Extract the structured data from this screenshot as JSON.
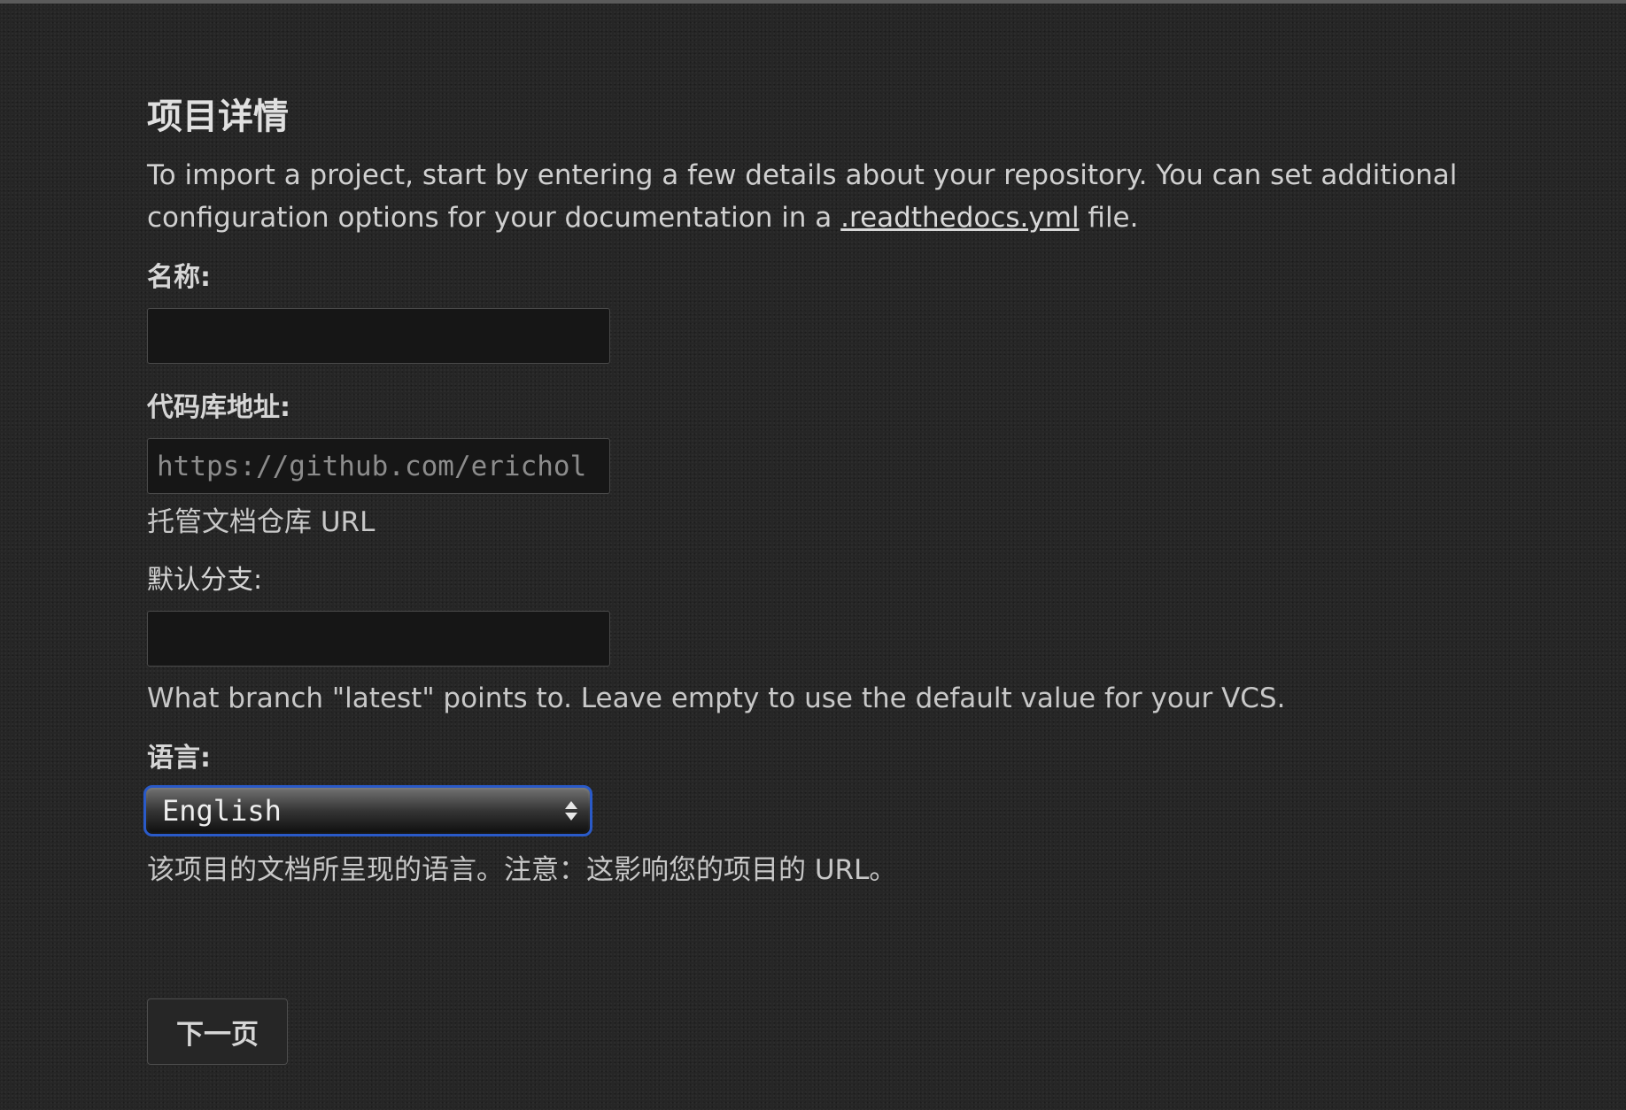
{
  "form": {
    "title": "项目详情",
    "intro_before_link": "To import a project, start by entering a few details about your repository. You can set additional configuration options for your documentation in a ",
    "intro_link": ".readthedocs.yml",
    "intro_after_link": " file.",
    "name": {
      "label": "名称:",
      "value": ""
    },
    "repo": {
      "label": "代码库地址:",
      "placeholder": "https://github.com/erichol",
      "help": "托管文档仓库 URL"
    },
    "branch": {
      "label": "默认分支:",
      "value": "",
      "help": "What branch \"latest\" points to. Leave empty to use the default value for your VCS."
    },
    "language": {
      "label": "语言:",
      "selected": "English",
      "help": "该项目的文档所呈现的语言。注意：这影响您的项目的 URL。"
    },
    "next_button": "下一页"
  }
}
